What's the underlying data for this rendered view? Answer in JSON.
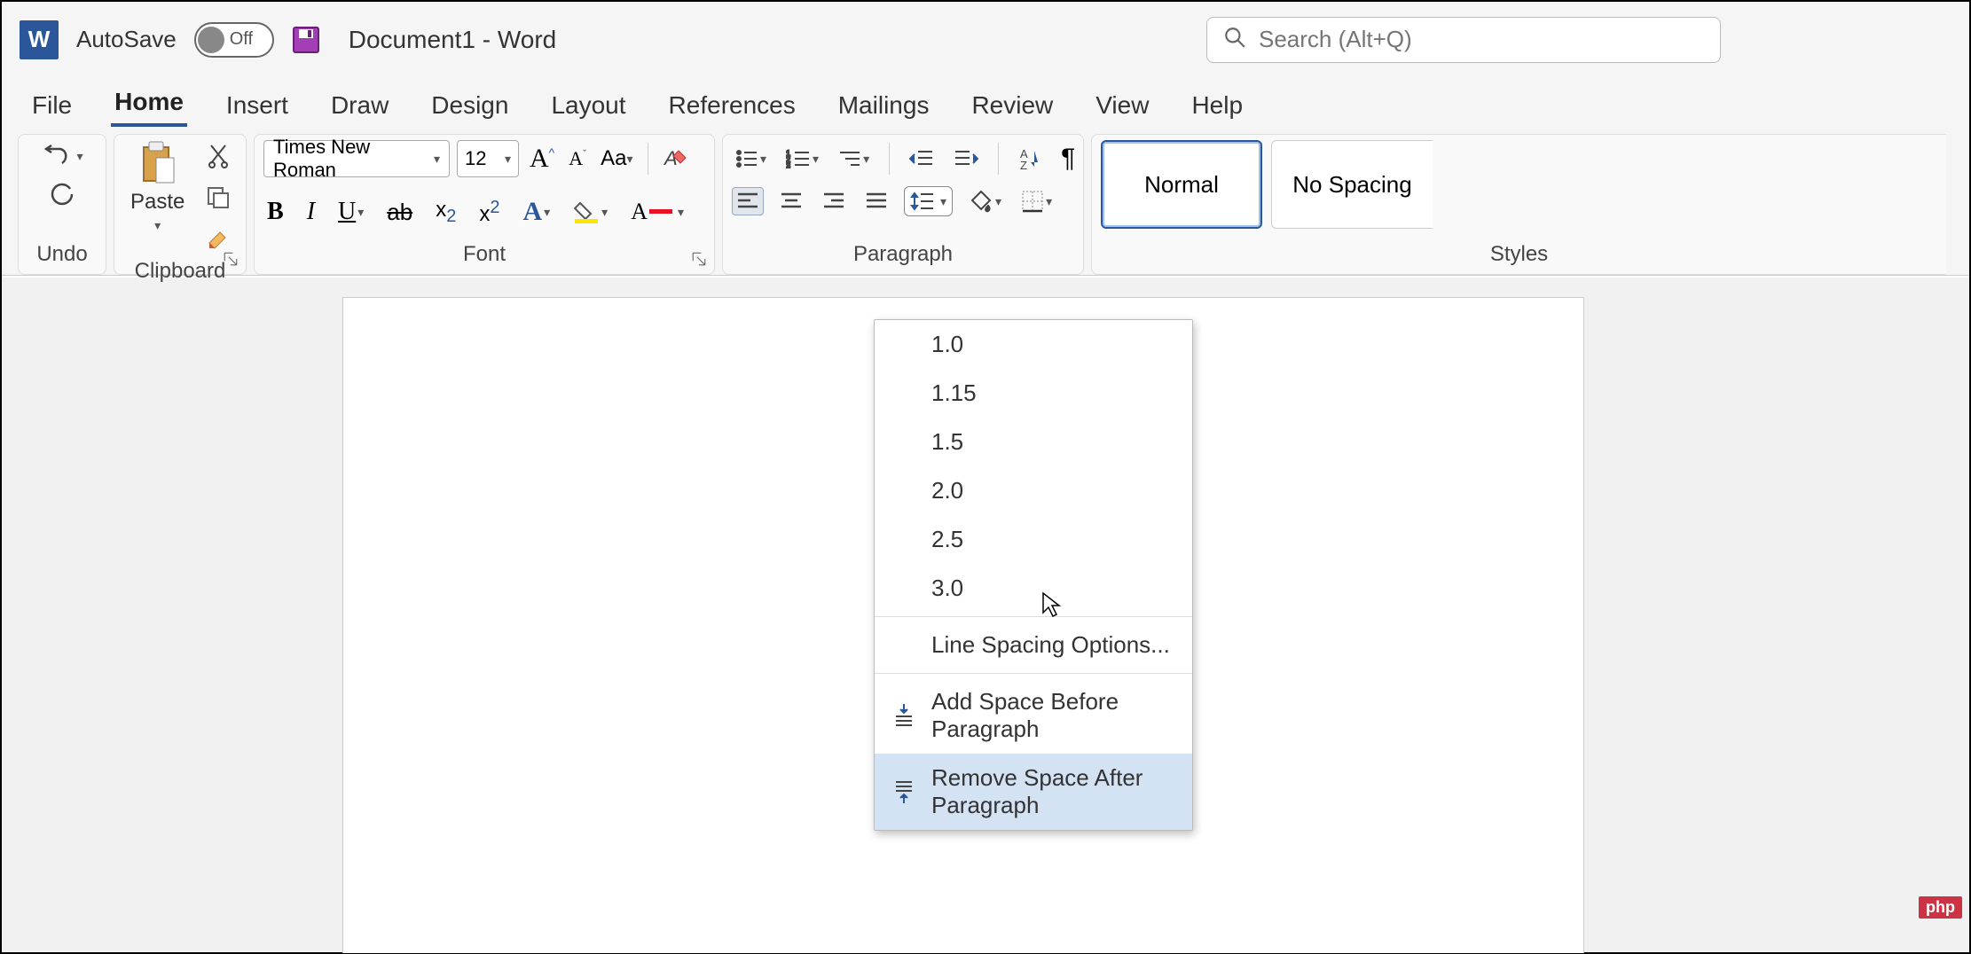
{
  "titlebar": {
    "app_icon_letter": "W",
    "autosave_label": "AutoSave",
    "autosave_state": "Off",
    "document_title": "Document1  -  Word",
    "search_placeholder": "Search (Alt+Q)"
  },
  "tabs": [
    "File",
    "Home",
    "Insert",
    "Draw",
    "Design",
    "Layout",
    "References",
    "Mailings",
    "Review",
    "View",
    "Help"
  ],
  "active_tab": "Home",
  "ribbon": {
    "undo_label": "Undo",
    "clipboard_label": "Clipboard",
    "paste_label": "Paste",
    "font_label": "Font",
    "font_name": "Times New Roman",
    "font_size": "12",
    "paragraph_label": "Paragraph",
    "styles_label": "Styles",
    "styles": [
      "Normal",
      "No Spacing"
    ]
  },
  "line_spacing_menu": {
    "values": [
      "1.0",
      "1.15",
      "1.5",
      "2.0",
      "2.5",
      "3.0"
    ],
    "options_label": "Line Spacing Options...",
    "add_before": "Add Space Before Paragraph",
    "remove_after": "Remove Space After Paragraph"
  },
  "badge": "php"
}
